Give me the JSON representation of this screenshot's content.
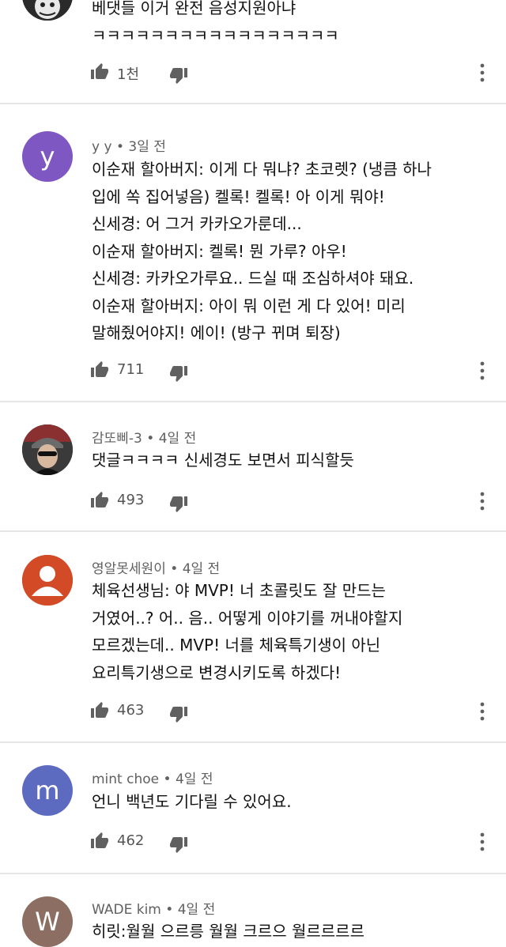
{
  "comments": [
    {
      "author": "",
      "time": "",
      "lines": [
        "베댓들 이거 완전 음성지원아냐",
        "ㅋㅋㅋㅋㅋㅋㅋㅋㅋㅋㅋㅋㅋㅋㅋㅋㅋ"
      ],
      "likes": "1천",
      "avatar": {
        "letter": "",
        "color": "#1a1a1a"
      }
    },
    {
      "author": "y y",
      "time": "3일 전",
      "lines": [
        "이순재 할아버지: 이게 다 뭐냐? 초코렛? (냉큼 하나",
        "입에 쏙 집어넣음) 켈록! 켈록! 아 이게 뭐야!",
        "신세경: 어 그거 카카오가룬데...",
        "이순재 할아버지: 켈록! 뭔 가루? 아우!",
        "신세경: 카카오가루요.. 드실 때 조심하셔야 돼요.",
        "이순재 할아버지: 아이 뭐 이런 게 다 있어! 미리",
        "말해줬어야지! 에이! (방구 뀌며 퇴장)"
      ],
      "likes": "711",
      "avatar": {
        "letter": "y",
        "color": "#7e57c2"
      }
    },
    {
      "author": "감또삐-3",
      "time": "4일 전",
      "lines": [
        "댓글ㅋㅋㅋㅋ 신세경도 보면서 피식할듯"
      ],
      "likes": "493",
      "avatar": {
        "letter": "",
        "color": "#2b2b2b"
      }
    },
    {
      "author": "영알못세원이",
      "time": "4일 전",
      "lines": [
        "체육선생님: 야 MVP! 너 초콜릿도 잘 만드는",
        "거였어..? 어.. 음.. 어떻게 이야기를 꺼내야할지",
        "모르겠는데.. MVP! 너를 체육특기생이 아닌",
        "요리특기생으로 변경시키도록 하겠다!"
      ],
      "likes": "463",
      "avatar": {
        "letter": "",
        "color": "#d24b26"
      }
    },
    {
      "author": "mint choe",
      "time": "4일 전",
      "lines": [
        "언니 백년도 기다릴 수 있어요."
      ],
      "likes": "462",
      "avatar": {
        "letter": "m",
        "color": "#5c6bc0"
      }
    },
    {
      "author": "WADE kim",
      "time": "4일 전",
      "lines": [
        "히릿:월월 으르릉 월월 크르으 월르르르르"
      ],
      "likes": "",
      "avatar": {
        "letter": "W",
        "color": "#8d6e63"
      }
    }
  ],
  "meta_separator": "•",
  "icons": {
    "like": "thumbs-up-icon",
    "dislike": "thumbs-down-icon",
    "more": "more-vertical-icon"
  }
}
